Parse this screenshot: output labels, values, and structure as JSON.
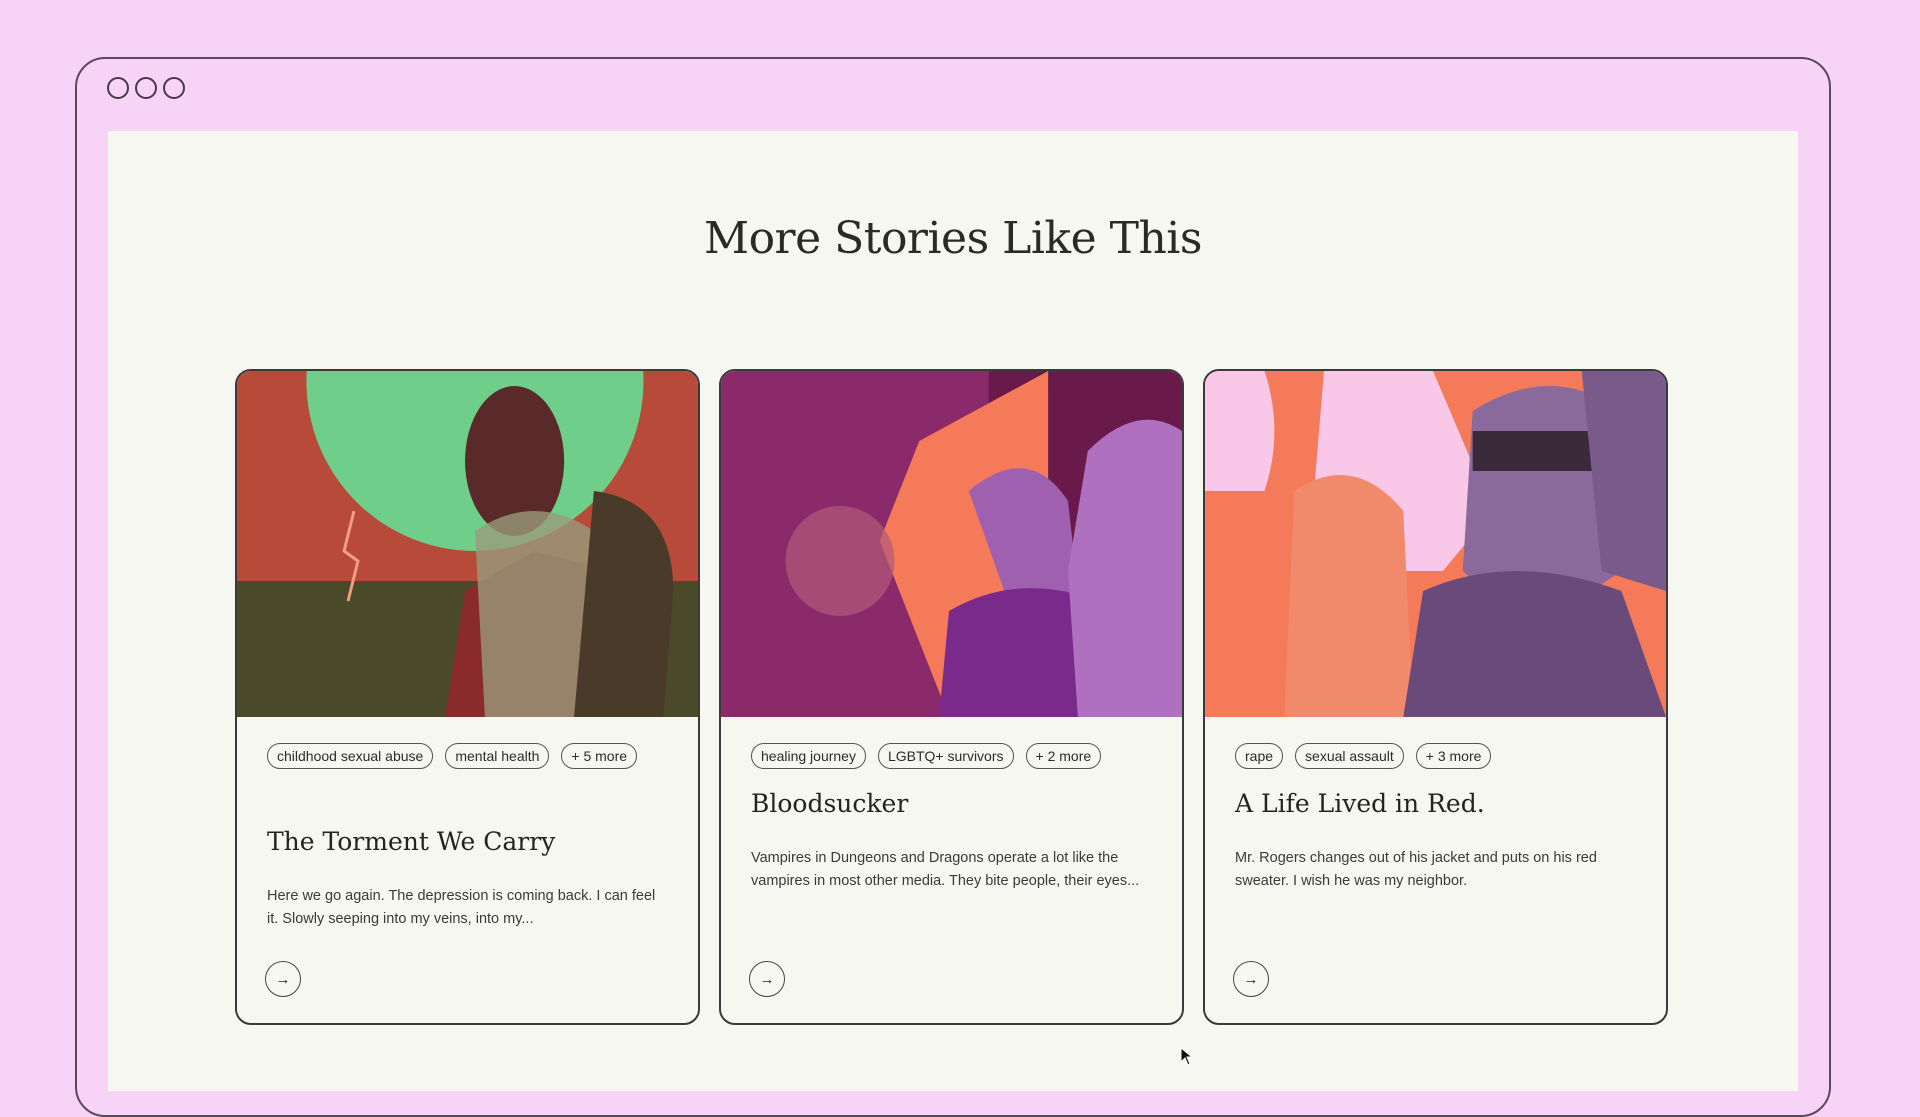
{
  "page": {
    "title": "More Stories Like This"
  },
  "cards": [
    {
      "tags": [
        "childhood sexual abuse",
        "mental health",
        "+ 5 more"
      ],
      "title": "The Torment We Carry",
      "description": "Here we go again. The depression is coming back. I can feel it. Slowly seeping into my veins, into my...",
      "arrow": "→"
    },
    {
      "tags": [
        "healing journey",
        "LGBTQ+ survivors",
        "+ 2 more"
      ],
      "title": "Bloodsucker",
      "description": "Vampires in Dungeons and Dragons operate a lot like the vampires in most other media. They bite people, their eyes...",
      "arrow": "→"
    },
    {
      "tags": [
        "rape",
        "sexual assault",
        "+ 3 more"
      ],
      "title": "A Life Lived in Red.",
      "description": "Mr. Rogers changes out of his jacket and puts on his red sweater. I wish he was my neighbor.",
      "arrow": "→"
    }
  ],
  "colors": {
    "background": "#f7d3f7",
    "page": "#f6f7f1",
    "green": "#6fcf8a",
    "magenta": "#8a2a6a",
    "coral": "#f47a5a"
  }
}
